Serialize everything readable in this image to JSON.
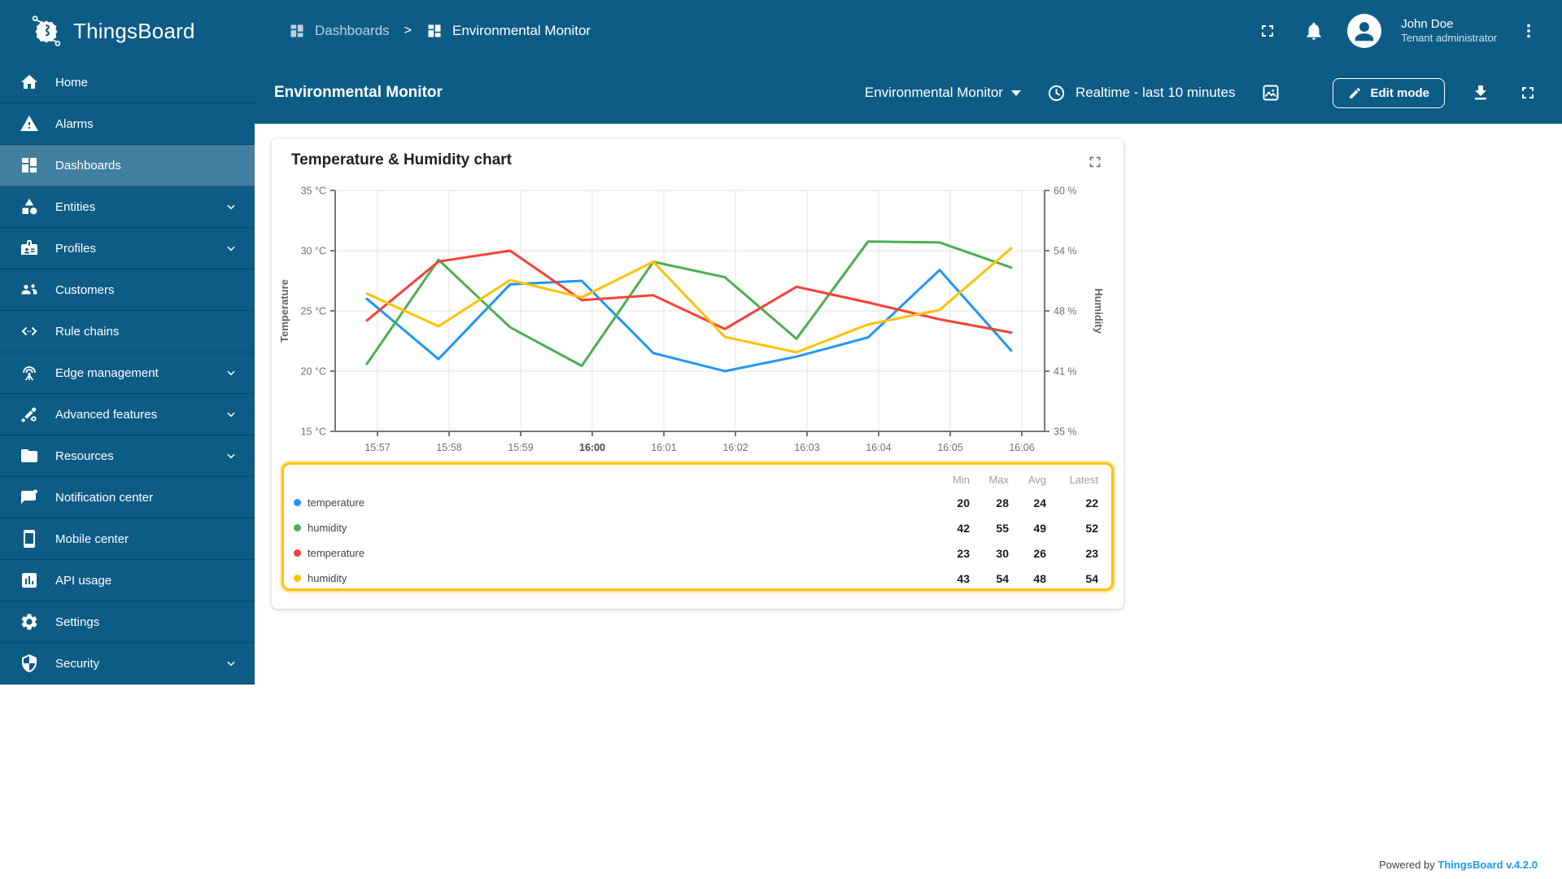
{
  "app": {
    "brand": "ThingsBoard",
    "powered_by": "Powered by",
    "version_link": "ThingsBoard v.4.2.0"
  },
  "header": {
    "breadcrumb": [
      {
        "label": "Dashboards"
      },
      {
        "label": "Environmental Monitor"
      }
    ],
    "separator": ">",
    "user": {
      "name": "John Doe",
      "role": "Tenant administrator"
    }
  },
  "toolbar": {
    "title": "Environmental Monitor",
    "dashboard_select": "Environmental Monitor",
    "timewindow": "Realtime - last 10 minutes",
    "edit_label": "Edit mode"
  },
  "sidebar": {
    "items": [
      {
        "label": "Home",
        "icon": "home"
      },
      {
        "label": "Alarms",
        "icon": "alarm-triangle"
      },
      {
        "label": "Dashboards",
        "icon": "dashboards-grid",
        "selected": true
      },
      {
        "label": "Entities",
        "icon": "entities-shapes",
        "expandable": true
      },
      {
        "label": "Profiles",
        "icon": "profile-badge",
        "expandable": true
      },
      {
        "label": "Customers",
        "icon": "people"
      },
      {
        "label": "Rule chains",
        "icon": "rule-chain"
      },
      {
        "label": "Edge management",
        "icon": "antenna",
        "expandable": true
      },
      {
        "label": "Advanced features",
        "icon": "tools",
        "expandable": true
      },
      {
        "label": "Resources",
        "icon": "folder",
        "expandable": true
      },
      {
        "label": "Notification center",
        "icon": "message-dot"
      },
      {
        "label": "Mobile center",
        "icon": "smartphone"
      },
      {
        "label": "API usage",
        "icon": "chart-box"
      },
      {
        "label": "Settings",
        "icon": "gear"
      },
      {
        "label": "Security",
        "icon": "shield",
        "expandable": true
      }
    ]
  },
  "widget": {
    "title": "Temperature & Humidity chart",
    "legend": {
      "headers": [
        "Min",
        "Max",
        "Avg",
        "Latest"
      ],
      "rows": [
        {
          "label": "temperature",
          "color": "#2196f3",
          "min": "20",
          "max": "28",
          "avg": "24",
          "latest": "22"
        },
        {
          "label": "humidity",
          "color": "#4caf50",
          "min": "42",
          "max": "55",
          "avg": "49",
          "latest": "52"
        },
        {
          "label": "temperature",
          "color": "#f44336",
          "min": "23",
          "max": "30",
          "avg": "26",
          "latest": "23"
        },
        {
          "label": "humidity",
          "color": "#ffc107",
          "min": "43",
          "max": "54",
          "avg": "48",
          "latest": "54"
        }
      ]
    }
  },
  "chart_data": {
    "type": "line",
    "x_labels": [
      "15:57",
      "15:58",
      "15:59",
      "16:00",
      "16:01",
      "16:02",
      "16:03",
      "16:04",
      "16:05",
      "16:06"
    ],
    "bold_x_label": "16:00",
    "grid": true,
    "legend_position": "bottom-table",
    "left_axis": {
      "label": "Temperature",
      "unit": "°C",
      "range": [
        15,
        35
      ],
      "ticks": [
        "35 °C",
        "30 °C",
        "25 °C",
        "20 °C",
        "15 °C"
      ]
    },
    "right_axis": {
      "label": "Humidity",
      "unit": "%",
      "range": [
        35,
        60
      ],
      "ticks": [
        "60 %",
        "54 %",
        "48 %",
        "41 %",
        "35 %"
      ]
    },
    "series": [
      {
        "name": "temperature",
        "axis": "left",
        "color": "#2196f3",
        "values": [
          26,
          21,
          27.2,
          27.5,
          21.5,
          20,
          21.2,
          22.8,
          28.4,
          21.7
        ]
      },
      {
        "name": "humidity",
        "axis": "right",
        "color": "#4caf50",
        "values": [
          42,
          52.8,
          45.8,
          41.8,
          52.6,
          51,
          44.6,
          54.7,
          54.6,
          52
        ]
      },
      {
        "name": "temperature",
        "axis": "left",
        "color": "#f44336",
        "values": [
          24.2,
          29.1,
          30,
          25.9,
          26.3,
          23.5,
          27,
          25.7,
          24.3,
          23.2
        ]
      },
      {
        "name": "humidity",
        "axis": "right",
        "color": "#ffc107",
        "values": [
          49.3,
          45.9,
          50.7,
          48.9,
          52.6,
          44.8,
          43.2,
          46.1,
          47.6,
          54
        ]
      }
    ]
  }
}
